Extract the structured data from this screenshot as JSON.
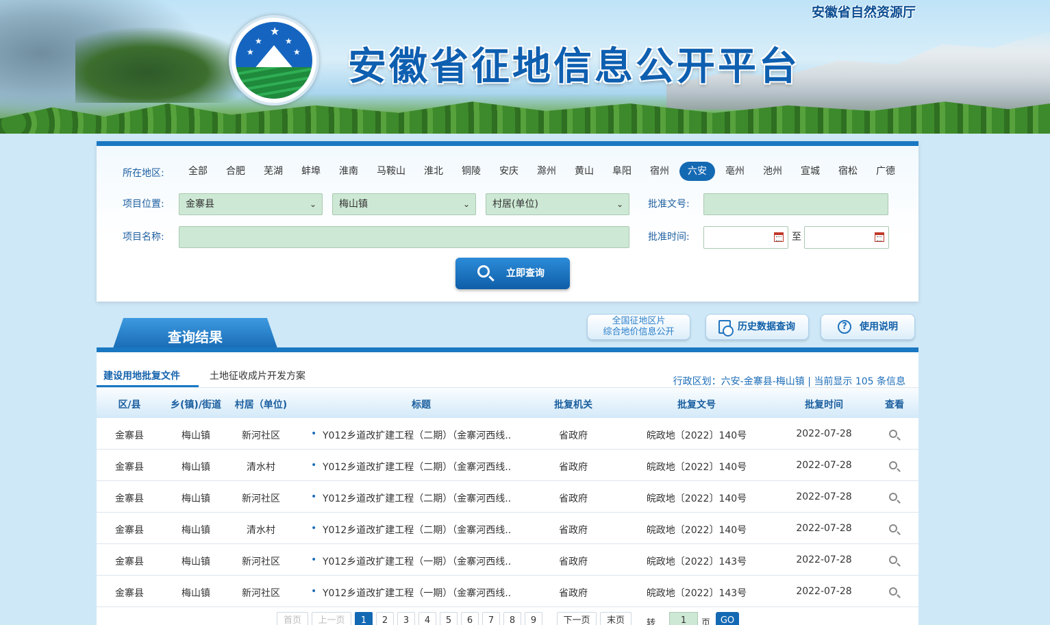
{
  "header": {
    "site_title": "安徽省征地信息公开平台",
    "org_name": "安徽省自然资源厅"
  },
  "search": {
    "region_label": "所在地区:",
    "regions": [
      "全部",
      "合肥",
      "芜湖",
      "蚌埠",
      "淮南",
      "马鞍山",
      "淮北",
      "铜陵",
      "安庆",
      "滁州",
      "黄山",
      "阜阳",
      "宿州",
      "六安",
      "亳州",
      "池州",
      "宣城",
      "宿松",
      "广德"
    ],
    "active_region": "六安",
    "location_label": "项目位置:",
    "county_value": "金寨县",
    "town_value": "梅山镇",
    "village_value": "村居(单位)",
    "approval_no_label": "批准文号:",
    "approval_no_value": "",
    "project_name_label": "项目名称:",
    "project_name_value": "",
    "approval_time_label": "批准时间:",
    "date_to": "至",
    "date_from_value": "",
    "date_to_value": "",
    "submit_label": "立即查询"
  },
  "results_header": {
    "title": "查询结果",
    "btn_national_line1": "全国征地区片",
    "btn_national_line2": "综合地价信息公开",
    "btn_history": "历史数据查询",
    "btn_help": "使用说明"
  },
  "results": {
    "tabs": [
      "建设用地批复文件",
      "土地征收成片开发方案"
    ],
    "active_tab": "建设用地批复文件",
    "region_info": "行政区划：六安-金寨县-梅山镇 | 当前显示 105 条信息",
    "columns": [
      "区/县",
      "乡(镇)/街道",
      "村居（单位)",
      "标题",
      "批复机关",
      "批复文号",
      "批复时间",
      "查看"
    ],
    "rows": [
      {
        "county": "金寨县",
        "town": "梅山镇",
        "village": "新河社区",
        "title": "Y012乡道改扩建工程（二期）（金寨河西线..",
        "authority": "省政府",
        "doc_no": "皖政地〔2022〕140号",
        "date": "2022-07-28"
      },
      {
        "county": "金寨县",
        "town": "梅山镇",
        "village": "清水村",
        "title": "Y012乡道改扩建工程（二期）（金寨河西线..",
        "authority": "省政府",
        "doc_no": "皖政地〔2022〕140号",
        "date": "2022-07-28"
      },
      {
        "county": "金寨县",
        "town": "梅山镇",
        "village": "新河社区",
        "title": "Y012乡道改扩建工程（二期）（金寨河西线..",
        "authority": "省政府",
        "doc_no": "皖政地〔2022〕140号",
        "date": "2022-07-28"
      },
      {
        "county": "金寨县",
        "town": "梅山镇",
        "village": "清水村",
        "title": "Y012乡道改扩建工程（二期）（金寨河西线..",
        "authority": "省政府",
        "doc_no": "皖政地〔2022〕140号",
        "date": "2022-07-28"
      },
      {
        "county": "金寨县",
        "town": "梅山镇",
        "village": "新河社区",
        "title": "Y012乡道改扩建工程（一期）（金寨河西线..",
        "authority": "省政府",
        "doc_no": "皖政地〔2022〕143号",
        "date": "2022-07-28"
      },
      {
        "county": "金寨县",
        "town": "梅山镇",
        "village": "新河社区",
        "title": "Y012乡道改扩建工程（一期）（金寨河西线..",
        "authority": "省政府",
        "doc_no": "皖政地〔2022〕143号",
        "date": "2022-07-28"
      }
    ]
  },
  "pagination": {
    "first": "首页",
    "prev": "上一页",
    "pages": [
      "1",
      "2",
      "3",
      "4",
      "5",
      "6",
      "7",
      "8",
      "9"
    ],
    "current": "1",
    "next": "下一页",
    "last": "末页",
    "goto_label": "转到",
    "goto_value": "1",
    "page_unit": "页",
    "go": "GO"
  }
}
